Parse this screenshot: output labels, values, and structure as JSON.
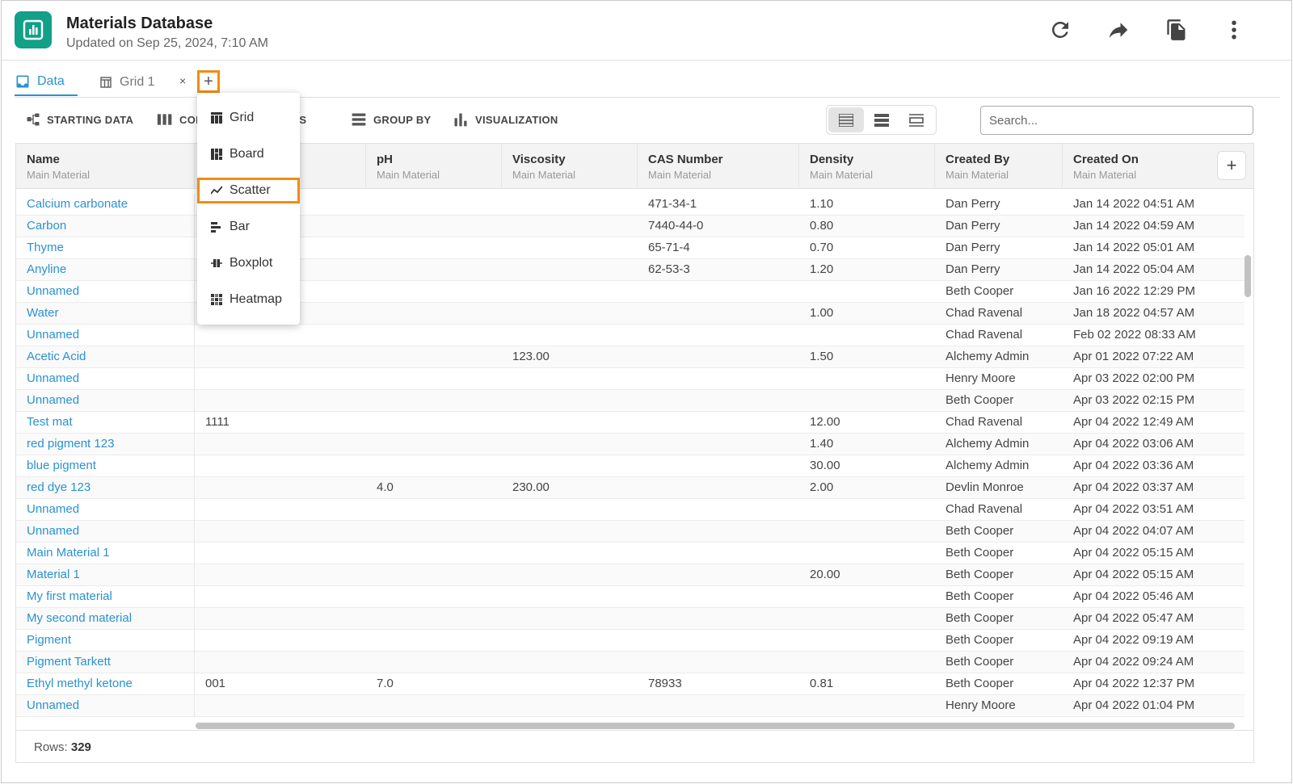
{
  "app": {
    "title": "Materials Database",
    "updated": "Updated on Sep 25, 2024, 7:10 AM",
    "accent_color": "#12a089",
    "link_color": "#2a92d0",
    "highlight_color": "#f08d12",
    "header_icons": [
      "refresh-icon",
      "share-icon",
      "copy-icon",
      "more-vertical-icon"
    ]
  },
  "tabs": [
    {
      "label": "Data",
      "icon": "inbox-icon",
      "active": true
    },
    {
      "label": "Grid 1",
      "icon": "table-icon",
      "active": false,
      "close": "×"
    }
  ],
  "tab_add_label": "+",
  "toolbar": {
    "starting_data": "STARTING DATA",
    "columns": "COLUMNS",
    "filters": "FILTERS",
    "group_by": "GROUP BY",
    "visualization": "VISUALIZATION"
  },
  "search": {
    "placeholder": "Search..."
  },
  "add_view_menu": [
    {
      "label": "Grid",
      "icon": "grid-icon"
    },
    {
      "label": "Board",
      "icon": "board-icon"
    },
    {
      "label": "Scatter",
      "icon": "scatter-icon",
      "highlighted": true
    },
    {
      "label": "Bar",
      "icon": "bar-icon"
    },
    {
      "label": "Boxplot",
      "icon": "boxplot-icon"
    },
    {
      "label": "Heatmap",
      "icon": "heatmap-icon"
    }
  ],
  "grid": {
    "columns": [
      {
        "title": "Name",
        "subtitle": "Main Material"
      },
      {
        "title": "",
        "subtitle": ""
      },
      {
        "title": "pH",
        "subtitle": "Main Material"
      },
      {
        "title": "Viscosity",
        "subtitle": "Main Material"
      },
      {
        "title": "CAS Number",
        "subtitle": "Main Material"
      },
      {
        "title": "Density",
        "subtitle": "Main Material"
      },
      {
        "title": "Created By",
        "subtitle": "Main Material"
      },
      {
        "title": "Created On",
        "subtitle": "Main Material"
      }
    ],
    "add_column_label": "+",
    "rows": [
      [
        "Calcium carbonate",
        "",
        "",
        "",
        "471-34-1",
        "1.10",
        "Dan Perry",
        "Jan 14 2022 04:51 AM"
      ],
      [
        "Carbon",
        "",
        "",
        "",
        "7440-44-0",
        "0.80",
        "Dan Perry",
        "Jan 14 2022 04:59 AM"
      ],
      [
        "Thyme",
        "",
        "",
        "",
        "65-71-4",
        "0.70",
        "Dan Perry",
        "Jan 14 2022 05:01 AM"
      ],
      [
        "Anyline",
        "",
        "",
        "",
        "62-53-3",
        "1.20",
        "Dan Perry",
        "Jan 14 2022 05:04 AM"
      ],
      [
        "Unnamed",
        "",
        "",
        "",
        "",
        "",
        "Beth Cooper",
        "Jan 16 2022 12:29 PM"
      ],
      [
        "Water",
        "",
        "",
        "",
        "",
        "1.00",
        "Chad Ravenal",
        "Jan 18 2022 04:57 AM"
      ],
      [
        "Unnamed",
        "",
        "",
        "",
        "",
        "",
        "Chad Ravenal",
        "Feb 02 2022 08:33 AM"
      ],
      [
        "Acetic Acid",
        "",
        "",
        "123.00",
        "",
        "1.50",
        "Alchemy Admin",
        "Apr 01 2022 07:22 AM"
      ],
      [
        "Unnamed",
        "",
        "",
        "",
        "",
        "",
        "Henry Moore",
        "Apr 03 2022 02:00 PM"
      ],
      [
        "Unnamed",
        "",
        "",
        "",
        "",
        "",
        "Beth Cooper",
        "Apr 03 2022 02:15 PM"
      ],
      [
        "Test mat",
        "1111",
        "",
        "",
        "",
        "12.00",
        "Chad Ravenal",
        "Apr 04 2022 12:49 AM"
      ],
      [
        "red pigment 123",
        "",
        "",
        "",
        "",
        "1.40",
        "Alchemy Admin",
        "Apr 04 2022 03:06 AM"
      ],
      [
        "blue pigment",
        "",
        "",
        "",
        "",
        "30.00",
        "Alchemy Admin",
        "Apr 04 2022 03:36 AM"
      ],
      [
        "red dye 123",
        "",
        "4.0",
        "230.00",
        "",
        "2.00",
        "Devlin Monroe",
        "Apr 04 2022 03:37 AM"
      ],
      [
        "Unnamed",
        "",
        "",
        "",
        "",
        "",
        "Chad Ravenal",
        "Apr 04 2022 03:51 AM"
      ],
      [
        "Unnamed",
        "",
        "",
        "",
        "",
        "",
        "Beth Cooper",
        "Apr 04 2022 04:07 AM"
      ],
      [
        "Main Material 1",
        "",
        "",
        "",
        "",
        "",
        "Beth Cooper",
        "Apr 04 2022 05:15 AM"
      ],
      [
        "Material 1",
        "",
        "",
        "",
        "",
        "20.00",
        "Beth Cooper",
        "Apr 04 2022 05:15 AM"
      ],
      [
        "My first material",
        "",
        "",
        "",
        "",
        "",
        "Beth Cooper",
        "Apr 04 2022 05:46 AM"
      ],
      [
        "My second material",
        "",
        "",
        "",
        "",
        "",
        "Beth Cooper",
        "Apr 04 2022 05:47 AM"
      ],
      [
        "Pigment",
        "",
        "",
        "",
        "",
        "",
        "Beth Cooper",
        "Apr 04 2022 09:19 AM"
      ],
      [
        "Pigment Tarkett",
        "",
        "",
        "",
        "",
        "",
        "Beth Cooper",
        "Apr 04 2022 09:24 AM"
      ],
      [
        "Ethyl methyl ketone",
        "001",
        "7.0",
        "",
        "78933",
        "0.81",
        "Beth Cooper",
        "Apr 04 2022 12:37 PM"
      ],
      [
        "Unnamed",
        "",
        "",
        "",
        "",
        "",
        "Henry Moore",
        "Apr 04 2022 01:04 PM"
      ]
    ]
  },
  "footer": {
    "rows_label": "Rows:",
    "rows_count": "329"
  }
}
